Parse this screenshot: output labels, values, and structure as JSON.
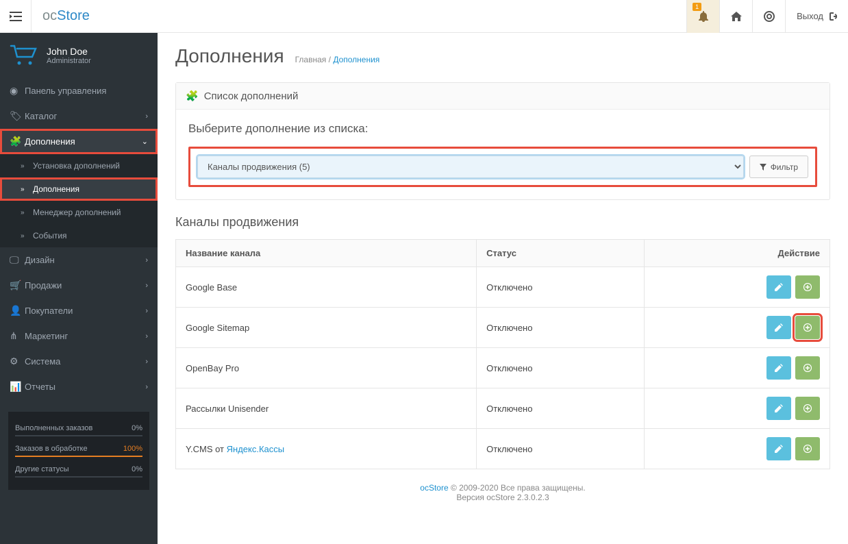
{
  "header": {
    "logo_prefix": "oc",
    "logo_suffix": "Store",
    "notif_count": "1",
    "logout": "Выход"
  },
  "profile": {
    "name": "John Doe",
    "role": "Administrator"
  },
  "nav": {
    "dashboard": "Панель управления",
    "catalog": "Каталог",
    "extensions": "Дополнения",
    "design": "Дизайн",
    "sales": "Продажи",
    "customers": "Покупатели",
    "marketing": "Маркетинг",
    "system": "Система",
    "reports": "Отчеты"
  },
  "subnav": {
    "install": "Установка дополнений",
    "extensions": "Дополнения",
    "modman": "Менеджер дополнений",
    "events": "События"
  },
  "stats": {
    "row1_label": "Выполненных заказов",
    "row1_val": "0%",
    "row2_label": "Заказов в обработке",
    "row2_val": "100%",
    "row3_label": "Другие статусы",
    "row3_val": "0%"
  },
  "page": {
    "title": "Дополнения",
    "breadcrumb_home": "Главная",
    "breadcrumb_sep": " / ",
    "breadcrumb_current": "Дополнения",
    "panel_title": "Список дополнений",
    "select_label": "Выберите дополнение из списка:",
    "select_value": "Каналы продвижения (5)",
    "filter_btn": "Фильтр",
    "section_title": "Каналы продвижения"
  },
  "table": {
    "col_name": "Название канала",
    "col_status": "Статус",
    "col_action": "Действие",
    "rows": [
      {
        "name": "Google Base",
        "status": "Отключено",
        "link": false
      },
      {
        "name": "Google Sitemap",
        "status": "Отключено",
        "link": false
      },
      {
        "name": "OpenBay Pro",
        "status": "Отключено",
        "link": false
      },
      {
        "name": "Рассылки Unisender",
        "status": "Отключено",
        "link": false
      },
      {
        "name_prefix": "Y.CMS от ",
        "name_link": "Яндекс.Кассы",
        "status": "Отключено",
        "link": true
      }
    ]
  },
  "footer": {
    "brand": "ocStore",
    "copyright": " © 2009-2020 Все права защищены.",
    "version": "Версия ocStore 2.3.0.2.3"
  }
}
